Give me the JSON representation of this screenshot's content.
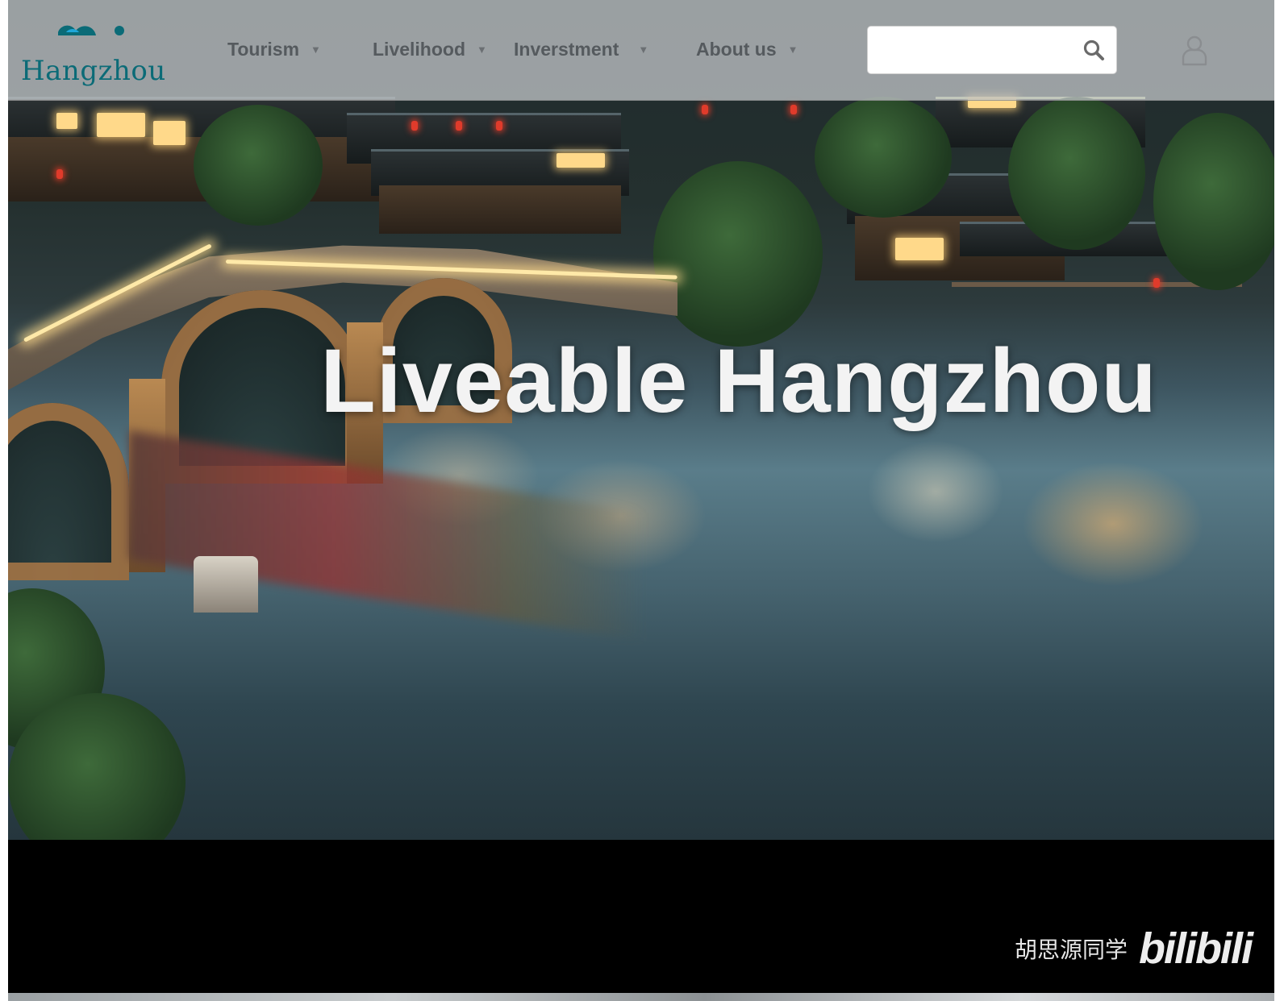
{
  "header": {
    "logo_text": "Hangzhou",
    "nav": [
      {
        "label": "Tourism"
      },
      {
        "label": "Livelihood"
      },
      {
        "label": "Inverstment"
      },
      {
        "label": "About us"
      }
    ],
    "search": {
      "value": "",
      "placeholder": ""
    }
  },
  "hero": {
    "title": "Liveable Hangzhou"
  },
  "watermark": {
    "user": "胡思源同学",
    "brand": "bilibili"
  },
  "colors": {
    "logo_text": "#0b6b77",
    "nav_text": "#555a5e",
    "hero_title": "#f3f3f3"
  }
}
